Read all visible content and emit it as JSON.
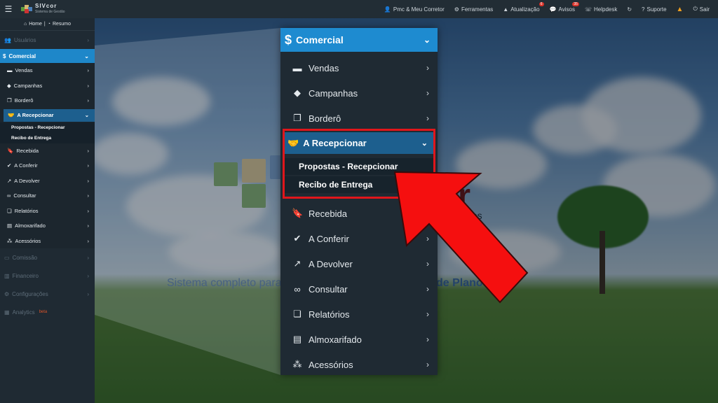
{
  "topbar": {
    "logo_title": "SIVcor",
    "logo_sub": "Sistema de Gestão",
    "items": [
      {
        "icon": "user-icon",
        "label": "Pmc & Meu Corretor"
      },
      {
        "icon": "gears-icon",
        "label": "Ferramentas"
      },
      {
        "icon": "warning-icon",
        "label": "Atualização",
        "badge": "6"
      },
      {
        "icon": "chat-icon",
        "label": "Avisos",
        "badge": "35"
      },
      {
        "icon": "helpdesk-icon",
        "label": "Helpdesk"
      },
      {
        "icon": "refresh-icon",
        "label": ""
      },
      {
        "icon": "question-icon",
        "label": "Suporte"
      },
      {
        "icon": "alert-icon",
        "label": ""
      },
      {
        "icon": "power-icon",
        "label": "Sair"
      }
    ]
  },
  "sidebar": {
    "home": "Home",
    "resumo": "Resumo",
    "usuarios": "Usuários",
    "comercial": "Comercial",
    "submenu": [
      {
        "icon": "briefcase-icon",
        "label": "Vendas"
      },
      {
        "icon": "tags-icon",
        "label": "Campanhas"
      },
      {
        "icon": "copy-icon",
        "label": "Borderô"
      }
    ],
    "a_recepcionar": "A Recepcionar",
    "leaves": [
      "Propostas - Recepcionar",
      "Recibo de Entrega"
    ],
    "submenu2": [
      {
        "icon": "bookmark-icon",
        "label": "Recebida"
      },
      {
        "icon": "check-circle-icon",
        "label": "A Conferir"
      },
      {
        "icon": "share-square-icon",
        "label": "A Devolver"
      },
      {
        "icon": "binoculars-icon",
        "label": "Consultar"
      },
      {
        "icon": "clone-icon",
        "label": "Relatórios"
      },
      {
        "icon": "archive-icon",
        "label": "Almoxarifado"
      },
      {
        "icon": "cubes-icon",
        "label": "Acessórios"
      }
    ],
    "bottom": [
      {
        "icon": "money-icon",
        "label": "Comissão"
      },
      {
        "icon": "bank-icon",
        "label": "Financeiro"
      },
      {
        "icon": "cogs-icon",
        "label": "Configurações"
      },
      {
        "icon": "bar-chart-icon",
        "label": "Analytics",
        "tag": "beta"
      }
    ]
  },
  "background": {
    "brand": "or",
    "brand_sub": "dos",
    "tagline_left": "Sistema completo para",
    "tagline_right": "de Plano   ude"
  },
  "zoom": {
    "header": "Comercial",
    "items_top": [
      "Vendas",
      "Campanhas",
      "Borderô"
    ],
    "active": "A Recepcionar",
    "leaves": [
      "Propostas - Recepcionar",
      "Recibo de Entrega"
    ],
    "items_bottom": [
      "Recebida",
      "A Conferir",
      "A Devolver",
      "Consultar",
      "Relatórios",
      "Almoxarifado",
      "Acessórios"
    ]
  },
  "colors": {
    "accent": "#1e8bd0",
    "active_sub": "#1d5f8e",
    "highlight": "#e0161b",
    "arrow": "#f50f0f"
  }
}
